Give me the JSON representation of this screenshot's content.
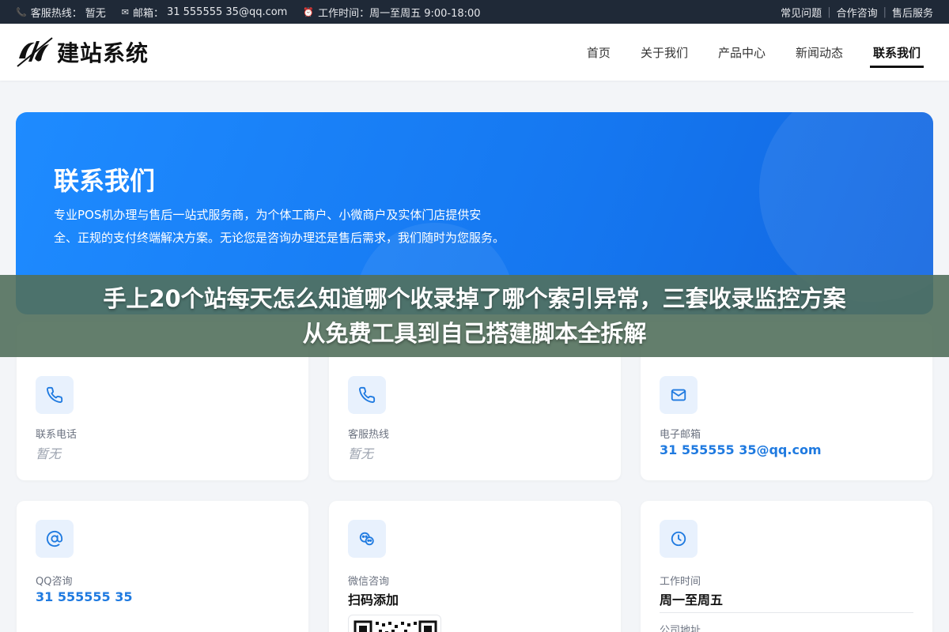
{
  "topbar": {
    "hotline_label": "客服热线：",
    "hotline_value": "暂无",
    "email_label": "邮箱：",
    "email_value": "31 555555 35@qq.com",
    "hours_label": "工作时间：",
    "hours_value": "周一至周五 9:00-18:00",
    "links": [
      "常见问题",
      "合作咨询",
      "售后服务"
    ]
  },
  "header": {
    "logo_text": "建站系统",
    "nav": [
      "首页",
      "关于我们",
      "产品中心",
      "新闻动态",
      "联系我们"
    ],
    "active_nav": "联系我们"
  },
  "hero": {
    "title": "联系我们",
    "description": "专业POS机办理与售后一站式服务商，为个体工商户、小微商户及实体门店提供安全、正规的支付终端解决方案。无论您是咨询办理还是售后需求，我们随时为您服务。"
  },
  "overlay": {
    "line1": "手上20个站每天怎么知道哪个收录掉了哪个索引异常，三套收录监控方案",
    "line2": "从免费工具到自己搭建脚本全拆解"
  },
  "cards": {
    "phone": {
      "label": "联系电话",
      "value": "暂无"
    },
    "hotline": {
      "label": "客服热线",
      "value": "暂无"
    },
    "email": {
      "label": "电子邮箱",
      "value": "31 555555 35@qq.com"
    },
    "qq": {
      "label": "QQ咨询",
      "value": "31 555555 35"
    },
    "wechat": {
      "label": "微信咨询",
      "value": "扫码添加"
    },
    "hours": {
      "label": "工作时间",
      "value": "周一至周五",
      "address_label": "公司地址"
    }
  },
  "colors": {
    "accent": "#1f7ae0",
    "hero": "#1e88ff",
    "overlay": "#52705c",
    "topbar": "#1f2937"
  }
}
